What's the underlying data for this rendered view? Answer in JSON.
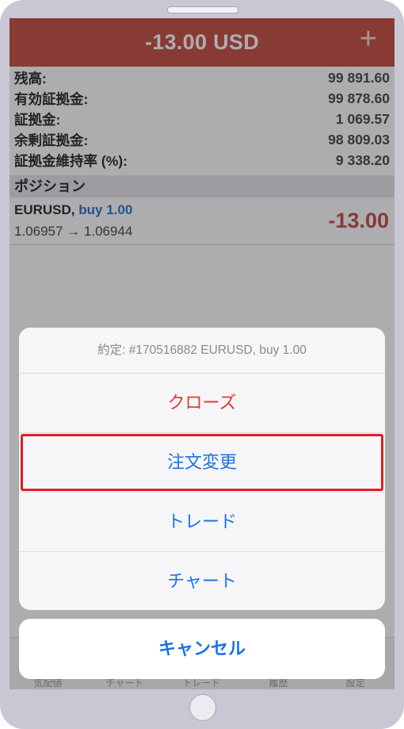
{
  "header": {
    "title": "-13.00 USD",
    "plus_glyph": "+"
  },
  "account": [
    {
      "label": "残高:",
      "value": "99 891.60"
    },
    {
      "label": "有効証拠金:",
      "value": "99 878.60"
    },
    {
      "label": "証拠金:",
      "value": "1 069.57"
    },
    {
      "label": "余剰証拠金:",
      "value": "98 809.03"
    },
    {
      "label": "証拠金維持率 (%):",
      "value": "9 338.20"
    }
  ],
  "positions_header": "ポジション",
  "position": {
    "symbol": "EURUSD,",
    "side": "buy 1.00",
    "prices": "1.06957 → 1.06944",
    "profit": "-13.00"
  },
  "tabs": [
    "気配値",
    "チャート",
    "トレード",
    "履歴",
    "設定"
  ],
  "sheet": {
    "message": "約定: #170516882 EURUSD, buy 1.00",
    "actions": [
      "クローズ",
      "注文変更",
      "トレード",
      "チャート"
    ],
    "cancel": "キャンセル"
  },
  "colors": {
    "header": "#c0392b",
    "action_blue": "#1a73e8",
    "destructive_red": "#e53935",
    "highlight_red": "#e11d22",
    "buy_blue": "#1565c0"
  }
}
